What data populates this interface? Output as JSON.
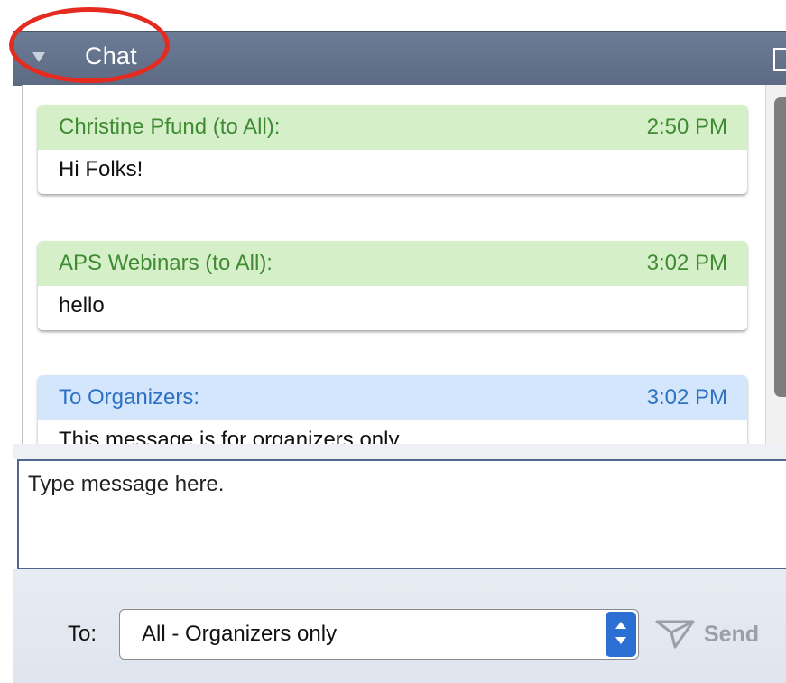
{
  "header": {
    "title": "Chat",
    "collapse_icon": "triangle-down-icon",
    "popout_icon": "popout-icon"
  },
  "messages": [
    {
      "sender": "Christine Pfund (to All):",
      "time": "2:50 PM",
      "text": "Hi Folks!",
      "style": "public"
    },
    {
      "sender": "APS Webinars (to All):",
      "time": "3:02 PM",
      "text": "hello",
      "style": "public"
    },
    {
      "sender": "To Organizers:",
      "time": "3:02 PM",
      "text": "This message is for organizers only",
      "style": "private"
    }
  ],
  "input": {
    "placeholder": "Type message here."
  },
  "recipient": {
    "label": "To:",
    "selected_prefix": "All -",
    "selected_suffix": "Organizers only"
  },
  "send": {
    "label": "Send",
    "icon": "paper-plane-icon"
  },
  "colors": {
    "header_bg": "#5f6d87",
    "public_header_bg": "#d5f0c8",
    "public_text": "#3f8a33",
    "private_header_bg": "#d3e6fb",
    "private_text": "#2f72c4",
    "highlight_circle": "#e52b1f",
    "stepper_accent": "#2c6fd3"
  }
}
